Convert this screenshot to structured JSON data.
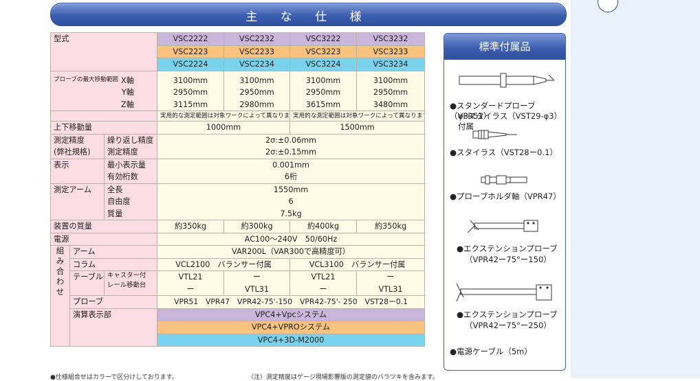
{
  "title": "主 な 仕 様",
  "models": {
    "row1": [
      "VSC2222",
      "VSC2232",
      "VSC3222",
      "VSC3232"
    ],
    "row2": [
      "VSC2223",
      "VSC2233",
      "VSC3223",
      "VSC3233"
    ],
    "row3": [
      "VSC2224",
      "VSC2234",
      "VSC3224",
      "VSC3234"
    ]
  },
  "labels": {
    "model": "型式",
    "range": "プローブの最大移動範囲",
    "x_axis": "X軸",
    "y_axis": "Y軸",
    "z_axis": "Z軸",
    "vertical": "上下移動量",
    "accuracy": "測定精度",
    "accuracy_note": "(弊社規格)",
    "repeat": "繰り返し精度",
    "measure": "測定精度",
    "display": "表示",
    "min_display": "最小表示量",
    "digits": "有効桁数",
    "arm": "測定アーム",
    "length": "全長",
    "dof": "自由度",
    "mass": "質量",
    "device_mass": "装置の質量",
    "power": "電源",
    "kumi": [
      "組",
      "み",
      "合",
      "わ",
      "せ"
    ],
    "k_arm": "アーム",
    "k_column": "コラム",
    "k_table": "テーブル",
    "k_caster": "キャスター付",
    "k_rail": "レール移動台",
    "k_probe": "プローブ",
    "k_compute": "演算表示部"
  },
  "values": {
    "x": [
      "3100mm",
      "3100mm",
      "3100mm",
      "3100mm"
    ],
    "y": [
      "2950mm",
      "2950mm",
      "2950mm",
      "2950mm"
    ],
    "z": [
      "3115mm",
      "2980mm",
      "3615mm",
      "3480mm"
    ],
    "range_note": "実用的な測定範囲は対象ワークによって異なります。",
    "vertical": [
      "1000mm",
      "1500mm"
    ],
    "repeat": "2σ:±0.06mm",
    "measure": "2σ:±0.15mm",
    "min_display": "0.001mm",
    "digits": "6桁",
    "length": "1550mm",
    "dof": "6",
    "mass": "7.5kg",
    "device_mass": [
      "約350kg",
      "約300kg",
      "約400kg",
      "約350kg"
    ],
    "power": "AC100～240V　50/60Hz",
    "arm": "VAR200L（VAR300で高精度可）",
    "column": [
      "VCL2100　バランサー付属",
      "VCL3100　バランサー付属"
    ],
    "table_top": [
      "VTL21",
      "ー",
      "VTL21",
      "ー"
    ],
    "table_bottom": [
      "ー",
      "VTL31",
      "ー",
      "VTL31"
    ],
    "probe": "VPR51　VPR47　VPR42-75'-150　VPR42-75'- 250　VST28ー0.1",
    "compute": [
      "VPC4+Vpcシステム",
      "VPC4+VPROシステム",
      "VPC4+3D-M2000"
    ]
  },
  "notes": {
    "left": "●仕様組合せはカラーで区分けしております。",
    "right": "（注）測定精度はゲージ現場影響版の測定値のバラツキを含みます。"
  },
  "accessories": {
    "title": "標準付属品",
    "items": [
      "●スタンダードプローブ（VPR51）",
      "φ3スタイラス（VST29-φ3）付属",
      "●スタイラス（VST28ー0.1）",
      "●プローブホルダ軸（VPR47）",
      "●エクステンションプローブ",
      "（VPR42ー75°ー150）",
      "●エクステンションプローブ",
      "（VPR42ー75°ー250）",
      "●電源ケーブル（5m）"
    ]
  },
  "colors": {
    "label_bg": "#fcdde5",
    "value_bg": "#fefae6",
    "purple": "#c9b6da",
    "orange": "#f9c27f",
    "cyan": "#79d2ee",
    "header_blue": "#3c5eaf"
  }
}
